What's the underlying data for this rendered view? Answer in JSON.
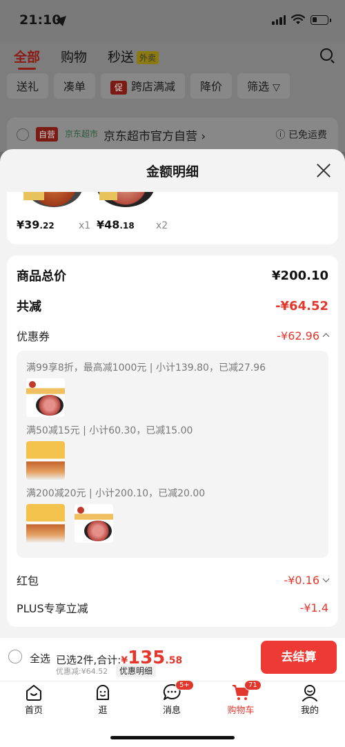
{
  "status_bar": {
    "time": "21:10"
  },
  "background": {
    "tabs": [
      "全部",
      "购物",
      "秒送"
    ],
    "takeout_badge": "外卖",
    "chips": [
      "送礼",
      "凑单",
      "跨店满减",
      "降价",
      "筛选"
    ],
    "chip_cu_label": "促",
    "store": {
      "self_badge": "自营",
      "supermarket_label": "京东超市",
      "name": "京东超市官方自营",
      "shipping": "已免运费"
    }
  },
  "sheet": {
    "title": "金额明细",
    "items": [
      {
        "price": "¥39",
        "price_dec": ".22",
        "qty": "x1"
      },
      {
        "price": "¥48",
        "price_dec": ".18",
        "qty": "x2"
      }
    ],
    "summary": {
      "total_label": "商品总价",
      "total_value": "¥200.10",
      "reduce_label": "共减",
      "reduce_value": "-¥64.52",
      "coupon_label": "优惠券",
      "coupon_value": "-¥62.96",
      "coupon_lines": [
        "满99享8折，最高减1000元 | 小计139.80，已减27.96",
        "满50减15元 | 小计60.30，已减15.00",
        "满200减20元 | 小计200.10，已减20.00"
      ],
      "redpack_label": "红包",
      "redpack_value": "-¥0.16",
      "plus_label": "PLUS专享立减",
      "plus_value": "-¥1.4"
    }
  },
  "checkout": {
    "select_all": "全选",
    "selected_text": "已选2件,合计:",
    "currency": "¥",
    "amount_int": "135",
    "amount_dec": ".58",
    "discount_text": "优惠减:¥64.52",
    "detail_link": "优惠明细",
    "button": "去结算"
  },
  "tabbar": {
    "items": [
      {
        "label": "首页",
        "icon": "home-icon"
      },
      {
        "label": "逛",
        "icon": "browse-icon"
      },
      {
        "label": "消息",
        "icon": "message-icon",
        "badge": "5+"
      },
      {
        "label": "购物车",
        "icon": "cart-icon",
        "badge": "71"
      },
      {
        "label": "我的",
        "icon": "profile-icon"
      }
    ]
  },
  "colors": {
    "accent": "#e2372c",
    "button": "#ee3a35"
  }
}
